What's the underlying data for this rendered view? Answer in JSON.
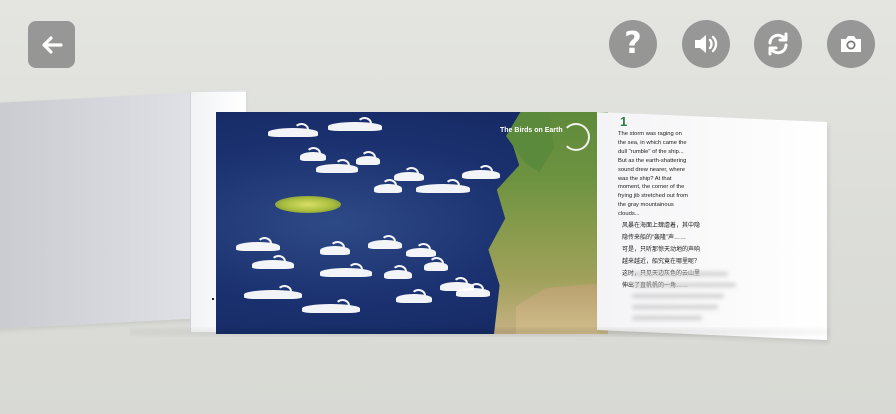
{
  "overlay": {
    "back_icon": "arrow-left-icon",
    "help_icon": "question-icon",
    "sound_icon": "speaker-icon",
    "refresh_icon": "refresh-icon",
    "camera_icon": "camera-icon",
    "help_glyph": "?"
  },
  "book": {
    "map_title": "The Birds on Earth",
    "page_number": "1",
    "english_lines": [
      "The storm was raging on",
      "the sea, in which came the",
      "dull \"rumble\" of the ship...",
      "But as the earth-shattering",
      "sound drew nearer, where",
      "was the ship? At that",
      "moment, the corner of the",
      "frying jib stretched out from",
      "the gray mountainous",
      "clouds..."
    ],
    "chinese_lines": [
      "风暴在海面上肆虐着，其中隐",
      "隐传来船的“轰隆”声……",
      "可是，只听那惊天动地的声响",
      "越来越近，船究竟在哪里呢？",
      "这时，只见天边灰色的云山里",
      "伸出了直帆帆的一角……"
    ]
  },
  "colors": {
    "overlay_button": "#787878",
    "page_number": "#2e7d46",
    "ocean": "#1b3170"
  }
}
